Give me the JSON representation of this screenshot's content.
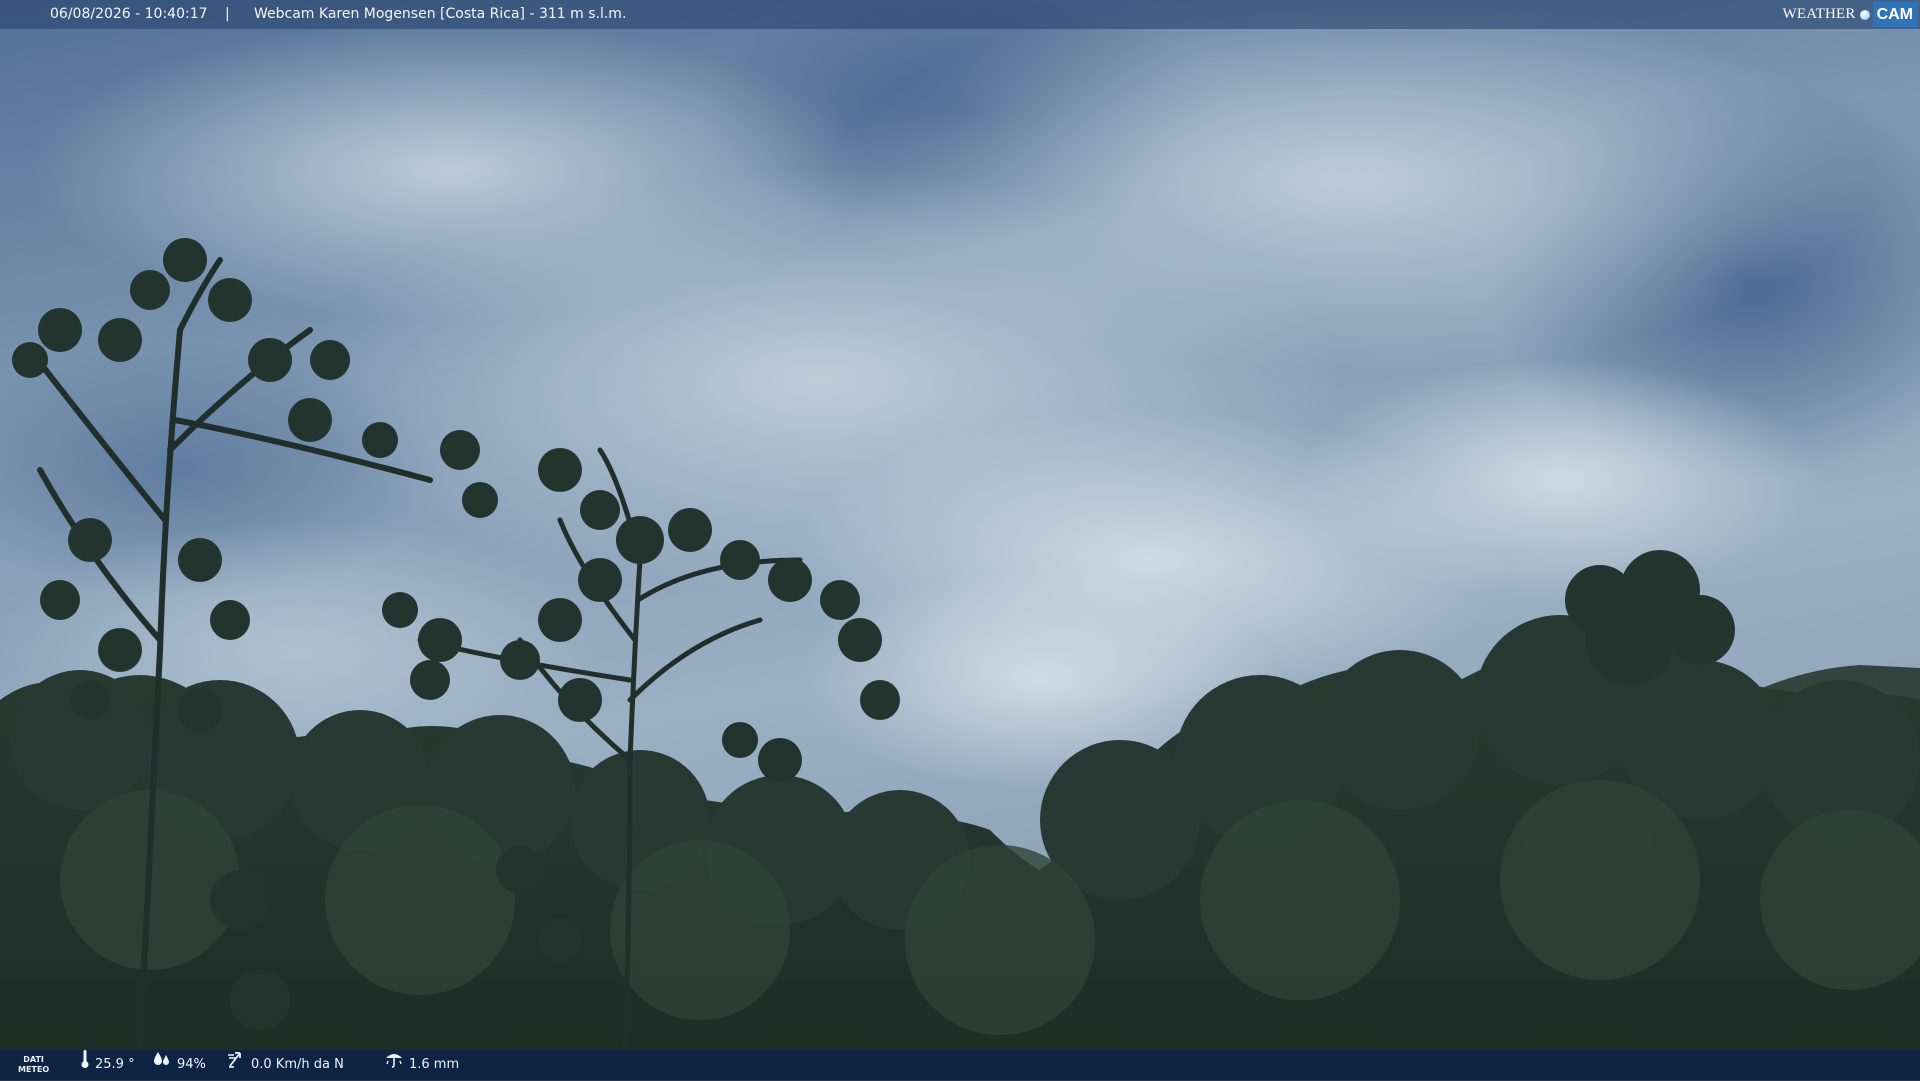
{
  "header": {
    "timestamp": "06/08/2026 - 10:40:17",
    "separator": "|",
    "title": "Webcam Karen Mogensen [Costa Rica]  - 311 m s.l.m."
  },
  "brand": {
    "weather": "WEATHER",
    "cam": "CAM"
  },
  "footer": {
    "meteo_line1": "DATI",
    "meteo_line2": "METEO",
    "temperature": "25.9 °",
    "humidity": "94%",
    "wind": "0.0 Km/h da N",
    "rain": "1.6 mm"
  },
  "icons": {
    "temperature": "thermometer-icon",
    "humidity": "humidity-drops-icon",
    "wind": "wind-vane-icon",
    "rain": "rain-gauge-icon"
  },
  "colors": {
    "header_bg": "#28466e",
    "footer_bg": "#0a234b",
    "brand_cam_bg": "#2f73b8",
    "sky_top": "#4f6f95",
    "sky_mid": "#9ab0c5",
    "foliage": "#1c2a22"
  }
}
